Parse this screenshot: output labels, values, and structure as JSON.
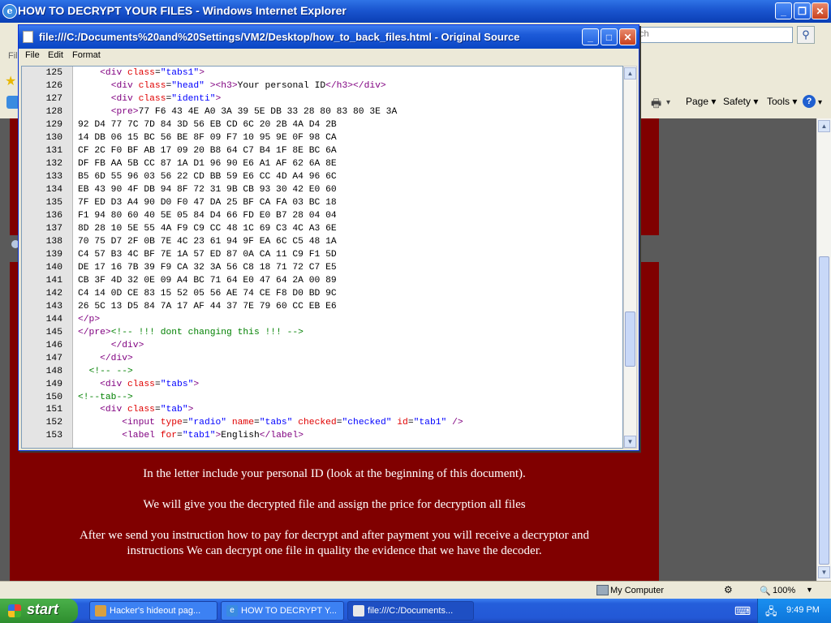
{
  "ie": {
    "title": "HOW TO DECRYPT YOUR FILES - Windows Internet Explorer",
    "search_placeholder": "ch",
    "menu_fragment": "Fil",
    "toolbar": {
      "page": "Page ▾",
      "safety": "Safety ▾",
      "tools": "Tools ▾"
    }
  },
  "source_window": {
    "title": "file:///C:/Documents%20and%20Settings/VM2/Desktop/how_to_back_files.html - Original Source",
    "menu": [
      "File",
      "Edit",
      "Format"
    ],
    "lines": [
      {
        "n": "125",
        "html": "    <span class=\"tag\">&lt;div</span> <span class=\"att\">class</span>=<span class=\"val\">\"tabs1\"</span><span class=\"tag\">&gt;</span>"
      },
      {
        "n": "126",
        "html": "      <span class=\"tag\">&lt;div</span> <span class=\"att\">class</span>=<span class=\"val\">\"head\"</span> <span class=\"tag\">&gt;&lt;h3&gt;</span>Your personal ID<span class=\"tag\">&lt;/h3&gt;&lt;/div&gt;</span>"
      },
      {
        "n": "127",
        "html": "      <span class=\"tag\">&lt;div</span> <span class=\"att\">class</span>=<span class=\"val\">\"identi\"</span><span class=\"tag\">&gt;</span>"
      },
      {
        "n": "128",
        "html": "      <span class=\"tag\">&lt;pre&gt;</span>77 F6 43 4E A0 3A 39 5E DB 33 28 80 83 80 3E 3A"
      },
      {
        "n": "129",
        "html": "92 D4 77 7C 7D 84 3D 56 EB CD 6C 20 2B 4A D4 2B"
      },
      {
        "n": "130",
        "html": "14 DB 06 15 BC 56 BE 8F 09 F7 10 95 9E 0F 98 CA"
      },
      {
        "n": "131",
        "html": "CF 2C F0 BF AB 17 09 20 B8 64 C7 B4 1F 8E BC 6A"
      },
      {
        "n": "132",
        "html": "DF FB AA 5B CC 87 1A D1 96 90 E6 A1 AF 62 6A 8E"
      },
      {
        "n": "133",
        "html": "B5 6D 55 96 03 56 22 CD BB 59 E6 CC 4D A4 96 6C"
      },
      {
        "n": "134",
        "html": "EB 43 90 4F DB 94 8F 72 31 9B CB 93 30 42 E0 60"
      },
      {
        "n": "135",
        "html": "7F ED D3 A4 90 D0 F0 47 DA 25 BF CA FA 03 BC 18"
      },
      {
        "n": "136",
        "html": "F1 94 80 60 40 5E 05 84 D4 66 FD E0 B7 28 04 04"
      },
      {
        "n": "137",
        "html": "8D 28 10 5E 55 4A F9 C9 CC 48 1C 69 C3 4C A3 6E"
      },
      {
        "n": "138",
        "html": "70 75 D7 2F 0B 7E 4C 23 61 94 9F EA 6C C5 48 1A"
      },
      {
        "n": "139",
        "html": "C4 57 B3 4C BF 7E 1A 57 ED 87 0A CA 11 C9 F1 5D"
      },
      {
        "n": "140",
        "html": "DE 17 16 7B 39 F9 CA 32 3A 56 C8 18 71 72 C7 E5"
      },
      {
        "n": "141",
        "html": "CB 3F 4D 32 0E 09 A4 BC 71 64 E0 47 64 2A 00 89"
      },
      {
        "n": "142",
        "html": "C4 14 0D CE 83 15 52 05 56 AE 74 CE F8 D0 BD 9C"
      },
      {
        "n": "143",
        "html": "26 5C 13 D5 84 7A 17 AF 44 37 7E 79 60 CC EB E6"
      },
      {
        "n": "144",
        "html": "<span class=\"tag\">&lt;/p&gt;</span>"
      },
      {
        "n": "145",
        "html": "<span class=\"tag\">&lt;/pre&gt;</span><span class=\"cmt\">&lt;!-- !!! dont changing this !!! --&gt;</span>"
      },
      {
        "n": "146",
        "html": "      <span class=\"tag\">&lt;/div&gt;</span>"
      },
      {
        "n": "147",
        "html": "    <span class=\"tag\">&lt;/div&gt;</span>"
      },
      {
        "n": "148",
        "html": "  <span class=\"cmt\">&lt;!-- --&gt;</span>"
      },
      {
        "n": "149",
        "html": "    <span class=\"tag\">&lt;div</span> <span class=\"att\">class</span>=<span class=\"val\">\"tabs\"</span><span class=\"tag\">&gt;</span>"
      },
      {
        "n": "150",
        "html": "<span class=\"cmt\">&lt;!--tab--&gt;</span>"
      },
      {
        "n": "151",
        "html": "    <span class=\"tag\">&lt;div</span> <span class=\"att\">class</span>=<span class=\"val\">\"tab\"</span><span class=\"tag\">&gt;</span>"
      },
      {
        "n": "152",
        "html": "        <span class=\"tag\">&lt;input</span> <span class=\"att\">type</span>=<span class=\"val\">\"radio\"</span> <span class=\"att\">name</span>=<span class=\"val\">\"tabs\"</span> <span class=\"att\">checked</span>=<span class=\"val\">\"checked\"</span> <span class=\"att\">id</span>=<span class=\"val\">\"tab1\"</span> <span class=\"tag\">/&gt;</span>"
      },
      {
        "n": "153",
        "html": "        <span class=\"tag\">&lt;label</span> <span class=\"att\">for</span>=<span class=\"val\">\"tab1\"</span><span class=\"tag\">&gt;</span>English<span class=\"tag\">&lt;/label&gt;</span>"
      }
    ]
  },
  "page": {
    "messages": [
      "In the letter include your personal ID (look at the beginning of this document).",
      "We will give you the decrypted file and assign the price for decryption all files",
      "After we send you instruction how to pay for decrypt and after payment you will receive a decryptor and",
      "instructions We can decrypt one file in quality the evidence that we have the decoder."
    ]
  },
  "status": {
    "zone": "My Computer",
    "zoom": "100%"
  },
  "taskbar": {
    "start": "start",
    "tasks": [
      "Hacker's hideout pag...",
      "HOW TO DECRYPT Y...",
      "file:///C:/Documents..."
    ],
    "clock": "9:49 PM"
  },
  "colors": {
    "page_bg": "#800000",
    "xp_blue": "#245edb",
    "tag": "#800080",
    "attr": "#e00000",
    "value": "#0000ff",
    "comment": "#008000"
  }
}
